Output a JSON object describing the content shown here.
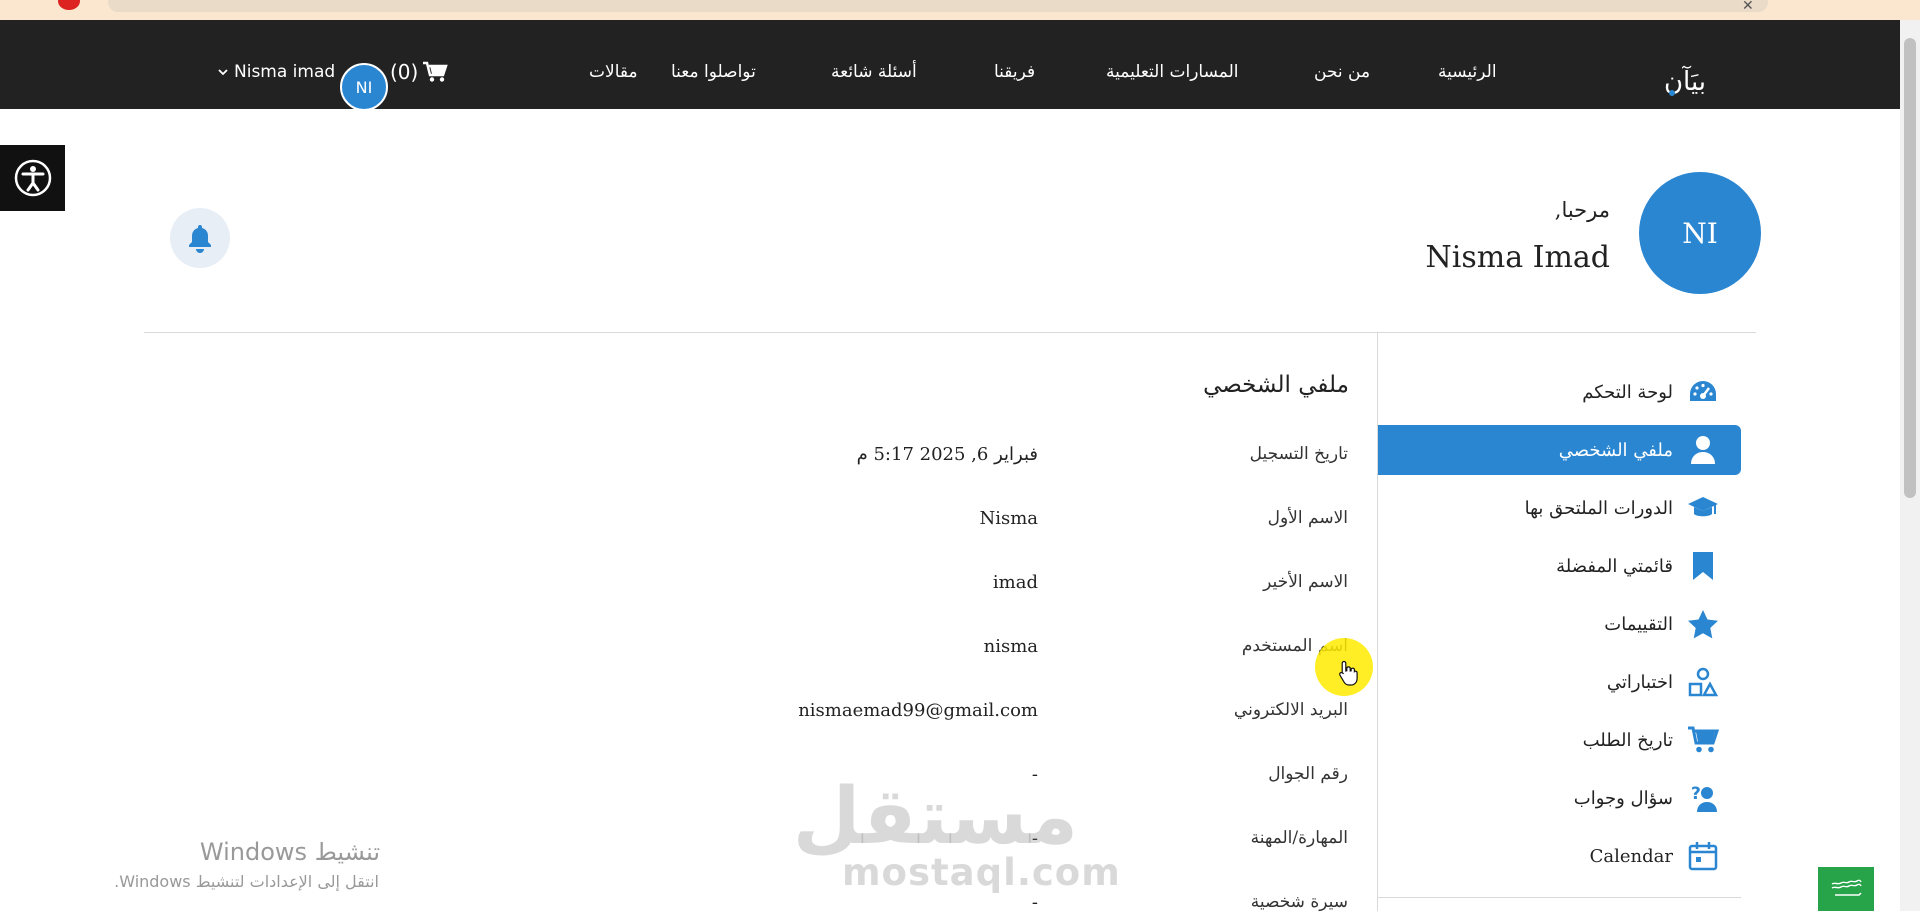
{
  "browser": {
    "close_glyph": "✕"
  },
  "navbar": {
    "items": [
      {
        "label": "الرئيسية"
      },
      {
        "label": "من نحن"
      },
      {
        "label": "المسارات التعليمية"
      },
      {
        "label": "فريقنا"
      },
      {
        "label": "أسئلة شائعة"
      },
      {
        "label": "تواصلوا معنا"
      },
      {
        "label": "مقالات"
      }
    ],
    "cart_count": "(0)",
    "avatar_initials": "NI",
    "user_name": "Nisma imad",
    "logo_text": "بيَآن"
  },
  "header": {
    "avatar_initials": "NI",
    "greeting": "مرحبا,",
    "full_name": "Nisma Imad"
  },
  "sidebar": {
    "items": [
      {
        "label": "لوحة التحكم",
        "icon": "dashboard-gauge-icon"
      },
      {
        "label": "ملفي الشخصي",
        "icon": "user-icon",
        "active": true
      },
      {
        "label": "الدورات الملتحق بها",
        "icon": "graduation-cap-icon"
      },
      {
        "label": "قائمتي المفضلة",
        "icon": "bookmark-icon"
      },
      {
        "label": "التقييمات",
        "icon": "star-icon"
      },
      {
        "label": "اختباراتي",
        "icon": "quiz-shapes-icon"
      },
      {
        "label": "تاريخ الطلب",
        "icon": "cart-icon"
      },
      {
        "label": "سؤال وجواب",
        "icon": "question-answer-icon"
      },
      {
        "label": "Calendar",
        "icon": "calendar-icon"
      }
    ]
  },
  "profile": {
    "title": "ملفي الشخصي",
    "fields": [
      {
        "label": "تاريخ التسجيل",
        "value": "فبراير 6, 2025 5:17 م"
      },
      {
        "label": "الاسم الأول",
        "value": "Nisma"
      },
      {
        "label": "الاسم الأخير",
        "value": "imad"
      },
      {
        "label": "اسم المستخدم",
        "value": "nisma"
      },
      {
        "label": "البريد الالكتروني",
        "value": "nismaemad99@gmail.com"
      },
      {
        "label": "رقم الجوال",
        "value": "-"
      },
      {
        "label": "المهارة/المهنة",
        "value": "-"
      },
      {
        "label": "سيرة شخصية",
        "value": "-"
      }
    ]
  },
  "watermark": {
    "arabic": "مستقل",
    "latin": "mostaql.com"
  },
  "windows_activation": {
    "title": "تنشيط Windows",
    "subtitle": "انتقل إلى الإعدادات لتنشيط Windows."
  },
  "colors": {
    "accent": "#2a86d1",
    "navbar": "#222222",
    "flag": "#27a34a"
  }
}
